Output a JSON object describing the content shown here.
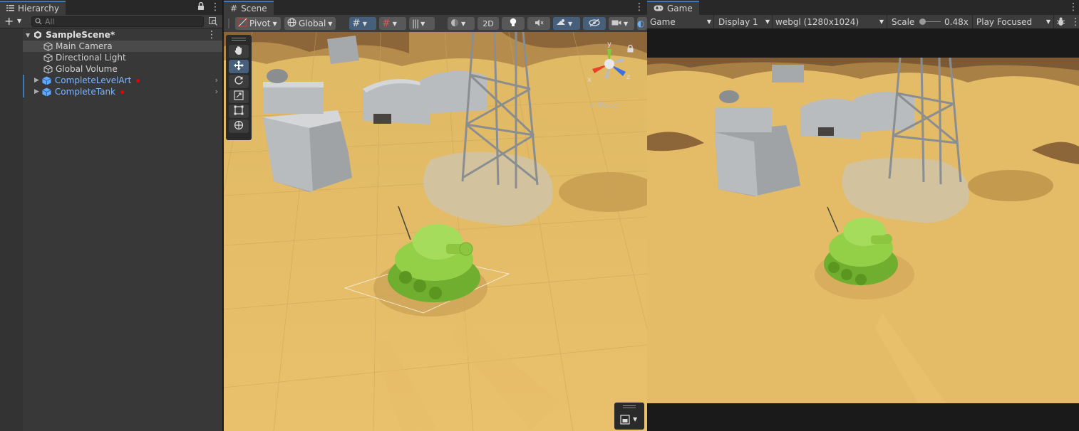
{
  "hierarchy": {
    "tab_label": "Hierarchy",
    "search_placeholder": "All",
    "scene_name": "SampleScene*",
    "items": [
      {
        "label": "Main Camera",
        "type": "gameobject"
      },
      {
        "label": "Directional Light",
        "type": "gameobject"
      },
      {
        "label": "Global Volume",
        "type": "gameobject"
      },
      {
        "label": "CompleteLevelArt",
        "type": "prefab"
      },
      {
        "label": "CompleteTank",
        "type": "prefab"
      }
    ]
  },
  "scene": {
    "tab_label": "Scene",
    "pivot_label": "Pivot",
    "global_label": "Global",
    "mode_2d_label": "2D",
    "persp_label": "< Persp",
    "gizmo_axes": {
      "x": "x",
      "y": "y",
      "z": "z"
    }
  },
  "game": {
    "tab_label": "Game",
    "view_mode": "Game",
    "display": "Display 1",
    "resolution": "webgl (1280x1024)",
    "scale_label": "Scale",
    "scale_value": "0.48x",
    "play_mode": "Play Focused"
  },
  "colors": {
    "accent": "#3a79bb",
    "prefab_text": "#7fb5ff",
    "modified_dot": "#ee0000",
    "sand": "#e8c16a"
  },
  "icons": [
    "list-icon",
    "lock-icon",
    "more-icon",
    "plus-icon",
    "search-icon",
    "cube-icon",
    "prefab-icon",
    "unity-icon",
    "hand-icon",
    "move-icon",
    "rotate-icon",
    "scale-icon",
    "rect-icon",
    "transform-icon",
    "grid-icon",
    "light-icon",
    "audio-icon",
    "effects-icon",
    "visibility-icon",
    "camera-icon",
    "gamepad-icon",
    "bug-icon"
  ]
}
